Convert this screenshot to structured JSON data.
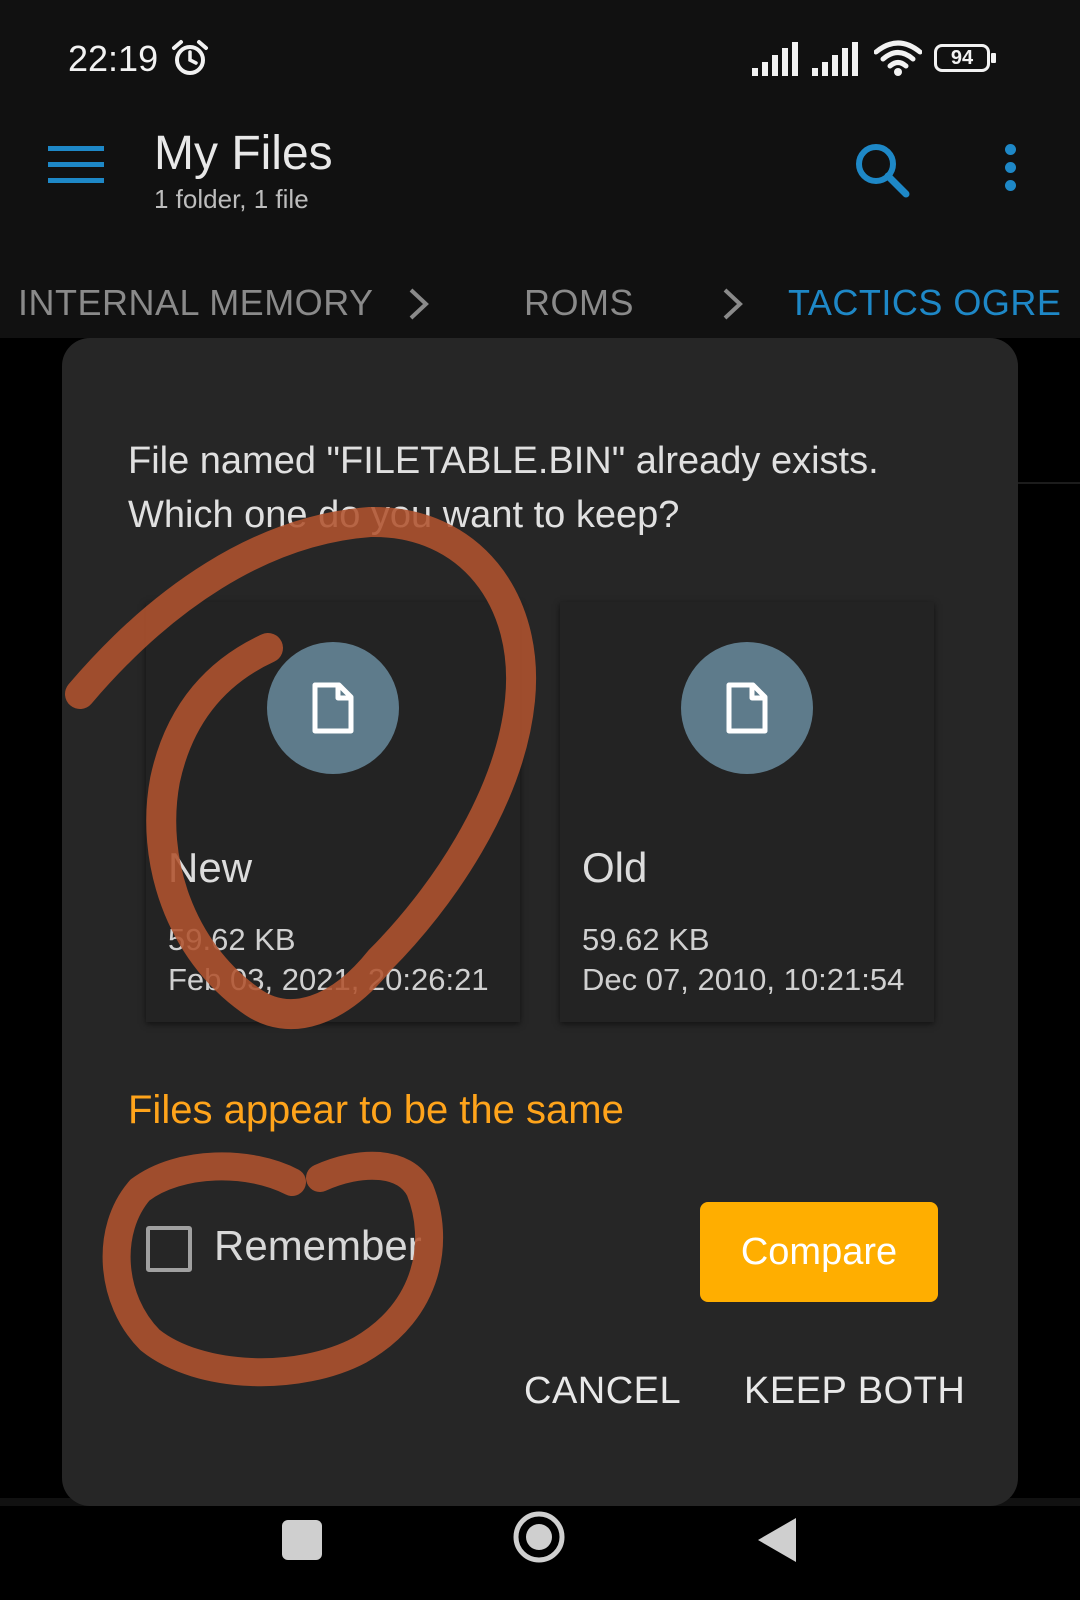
{
  "status_bar": {
    "time": "22:19",
    "battery": "94",
    "icons": [
      "alarm-icon",
      "signal-icon",
      "signal-icon",
      "wifi-icon",
      "battery-icon"
    ]
  },
  "app_bar": {
    "title": "My Files",
    "subtitle": "1 folder, 1 file",
    "icons": [
      "menu-icon",
      "search-icon",
      "more-vert-icon"
    ],
    "accent_color": "#1e88c7"
  },
  "breadcrumb": {
    "items": [
      {
        "label": "INTERNAL MEMORY"
      },
      {
        "label": "ROMS"
      },
      {
        "label": "TACTICS OGRE"
      }
    ],
    "active_color": "#1e88c7"
  },
  "dialog": {
    "message": "File named \"FILETABLE.BIN\" already exists. Which one do you want to keep?",
    "new_file": {
      "label": "New",
      "size": "59.62 KB",
      "date": "Feb 03, 2021, 20:26:21"
    },
    "old_file": {
      "label": "Old",
      "size": "59.62 KB",
      "date": "Dec 07, 2010, 10:21:54"
    },
    "same_notice": "Files appear to be the same",
    "remember_label": "Remember",
    "remember_checked": false,
    "compare_label": "Compare",
    "cancel_label": "CANCEL",
    "keep_both_label": "KEEP BOTH",
    "notice_color": "#ffa41b",
    "compare_color": "#ffae00"
  },
  "nav_bar": {
    "icons": [
      "recents-icon",
      "home-icon",
      "back-icon"
    ]
  }
}
